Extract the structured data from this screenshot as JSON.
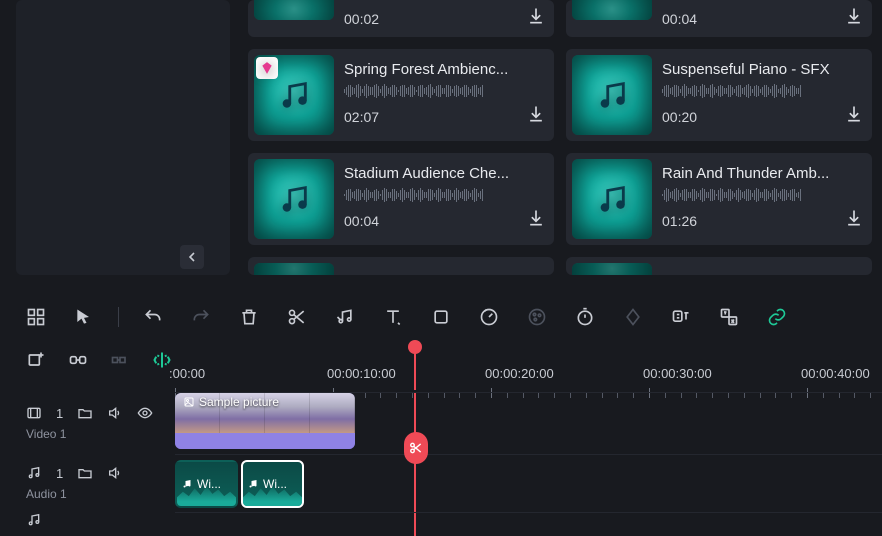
{
  "assets": {
    "row0": [
      {
        "title": "",
        "duration": "00:02",
        "hasGem": false
      },
      {
        "title": "",
        "duration": "00:04",
        "hasGem": false
      }
    ],
    "row1": [
      {
        "title": "Spring Forest Ambienc...",
        "duration": "02:07",
        "hasGem": true
      },
      {
        "title": "Suspenseful Piano - SFX",
        "duration": "00:20",
        "hasGem": false
      }
    ],
    "row2": [
      {
        "title": "Stadium Audience Che...",
        "duration": "00:04",
        "hasGem": false
      },
      {
        "title": "Rain And Thunder Amb...",
        "duration": "01:26",
        "hasGem": false
      }
    ]
  },
  "timeline": {
    "ruler": {
      "t0": ":00:00",
      "t1": "00:00:10:00",
      "t2": "00:00:20:00",
      "t3": "00:00:30:00",
      "t4": "00:00:40:00"
    },
    "tracks": {
      "video1": {
        "indexLabel": "1",
        "name": "Video 1",
        "clip": {
          "title": "Sample picture"
        }
      },
      "audio1": {
        "indexLabel": "1",
        "name": "Audio 1",
        "clip1": {
          "title": "Wi..."
        },
        "clip2": {
          "title": "Wi..."
        }
      }
    }
  },
  "colors": {
    "accent": "#1ec997",
    "playhead": "#ef4a56",
    "thumb": "#1abfa8"
  }
}
